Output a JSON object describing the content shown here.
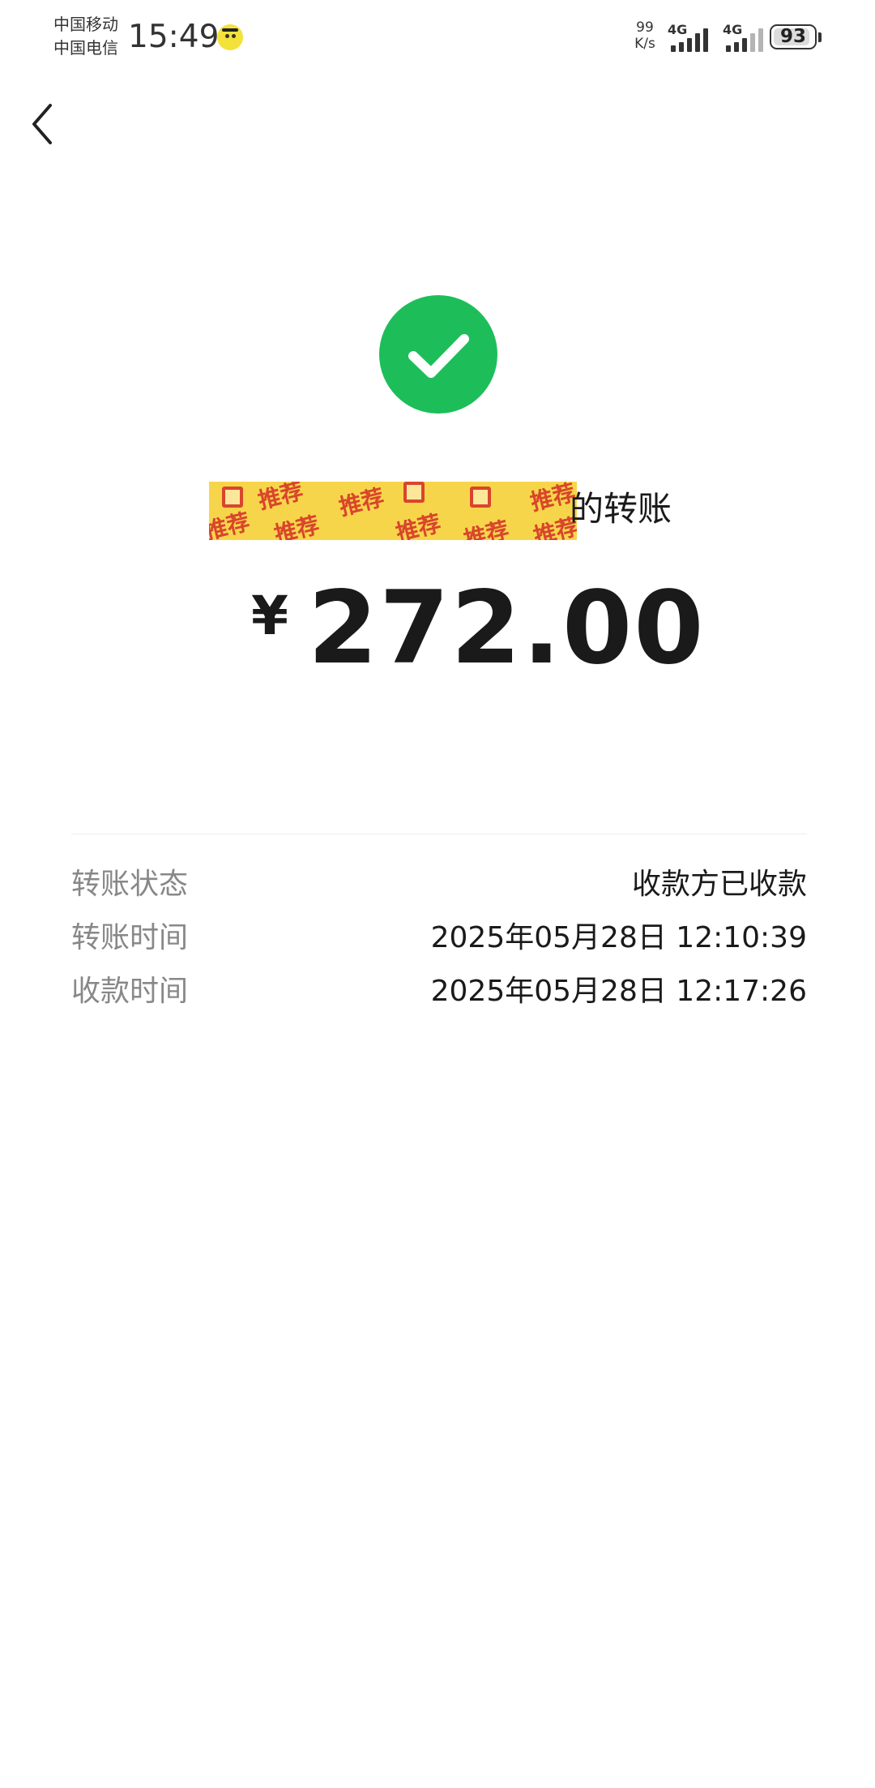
{
  "status_bar": {
    "carrier_1": "中国移动",
    "carrier_2": "中国电信",
    "time": "15:49",
    "net_speed_value": "99",
    "net_speed_unit": "K/s",
    "network_1": "4G",
    "network_2": "4G",
    "battery_level": "93",
    "battery_fraction": 0.93,
    "notification_icon": "face-sticker-icon"
  },
  "nav": {
    "back_icon": "chevron-left-icon"
  },
  "result": {
    "status_icon": "check-circle-icon",
    "status_icon_color": "#1dbe5a",
    "payer_redacted": true,
    "redaction_sticker_text": "推荐",
    "transfer_suffix": "的转账",
    "currency_symbol": "¥",
    "amount": "272.00"
  },
  "details": [
    {
      "label": "转账状态",
      "value": "收款方已收款"
    },
    {
      "label": "转账时间",
      "value": "2025年05月28日 12:10:39"
    },
    {
      "label": "收款时间",
      "value": "2025年05月28日 12:17:26"
    }
  ]
}
